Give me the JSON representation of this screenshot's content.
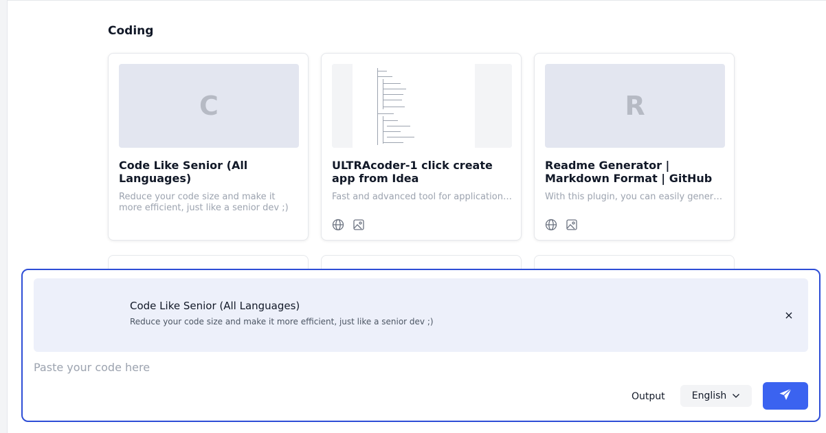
{
  "section": {
    "title": "Coding"
  },
  "cards": [
    {
      "thumb_letter": "C",
      "title": "Code Like Senior (All Languages)",
      "description": "Reduce your code size and make it more efficient, just like a senior dev ;)"
    },
    {
      "thumb_letter": "",
      "title": "ULTRAcoder-1 click create app from Idea",
      "description": "Fast and advanced tool for application development"
    },
    {
      "thumb_letter": "R",
      "title": "Readme Generator | Markdown Format | GitHub",
      "description": "With this plugin, you can easily generate readme files"
    }
  ],
  "card_icons": [
    "globe-icon",
    "image-icon"
  ],
  "composer": {
    "plugin_name": "Code Like Senior (All Languages)",
    "plugin_description": "Reduce your code size and make it more efficient, just like a senior dev ;)",
    "close_label": "×",
    "input_placeholder": "Paste your code here",
    "input_value": "",
    "output_label": "Output",
    "language_selected": "English",
    "send_icon": "send-icon"
  },
  "colors": {
    "accent": "#2d4dd6",
    "send_button": "#3b63f0",
    "banner_bg": "#edf0fa",
    "thumb_bg": "#e3e6f0"
  }
}
